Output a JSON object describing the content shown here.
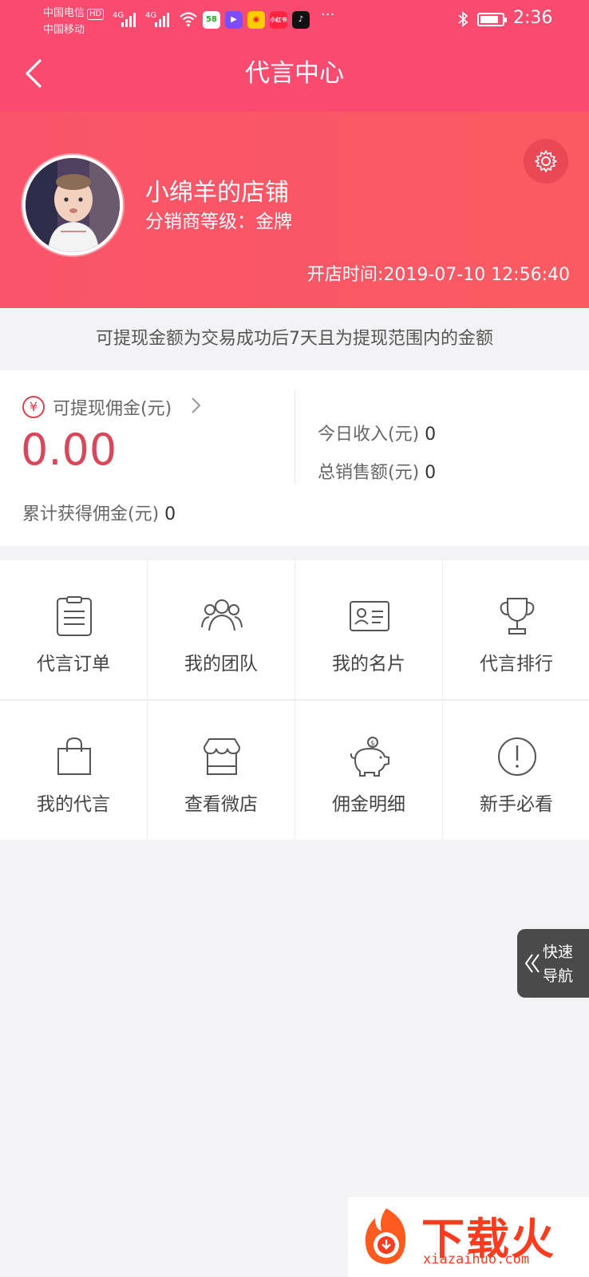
{
  "status_bar": {
    "carrier_1": "中国电信",
    "carrier_hd": "HD",
    "carrier_2": "中国移动",
    "signal_1": "4G",
    "signal_2": "4G",
    "app_icons": [
      "58",
      "微视",
      "微博",
      "小红书",
      "抖音"
    ],
    "more": "···",
    "time": "2:36"
  },
  "nav": {
    "title": "代言中心",
    "back_icon": "chevron-left-icon"
  },
  "shop": {
    "name": "小绵羊的店铺",
    "level": "分销商等级：金牌",
    "open_time": "开店时间:2019-07-10 12:56:40",
    "settings_icon": "gear-icon"
  },
  "notice": "可提现金额为交易成功后7天且为提现范围内的金额",
  "commission": {
    "yen_symbol": "¥",
    "withdrawable_label": "可提现佣金(元)",
    "withdrawable_value": "0.00",
    "total_label": "累计获得佣金(元)",
    "total_value": "0",
    "today_label": "今日收入(元)",
    "today_value": "0",
    "sales_label": "总销售额(元)",
    "sales_value": "0"
  },
  "grid": [
    {
      "label": "代言订单",
      "icon": "clipboard-icon"
    },
    {
      "label": "我的团队",
      "icon": "team-icon"
    },
    {
      "label": "我的名片",
      "icon": "id-card-icon"
    },
    {
      "label": "代言排行",
      "icon": "trophy-icon"
    },
    {
      "label": "我的代言",
      "icon": "shopping-bag-icon"
    },
    {
      "label": "查看微店",
      "icon": "store-icon"
    },
    {
      "label": "佣金明细",
      "icon": "piggy-bank-icon"
    },
    {
      "label": "新手必看",
      "icon": "exclamation-icon"
    }
  ],
  "quick_nav": {
    "line1": "快速",
    "line2": "导航"
  },
  "watermark": {
    "text": "下载火",
    "url": "xiazaihuo.com"
  },
  "colors": {
    "header": "#f94b6f",
    "accent": "#d9475a"
  }
}
